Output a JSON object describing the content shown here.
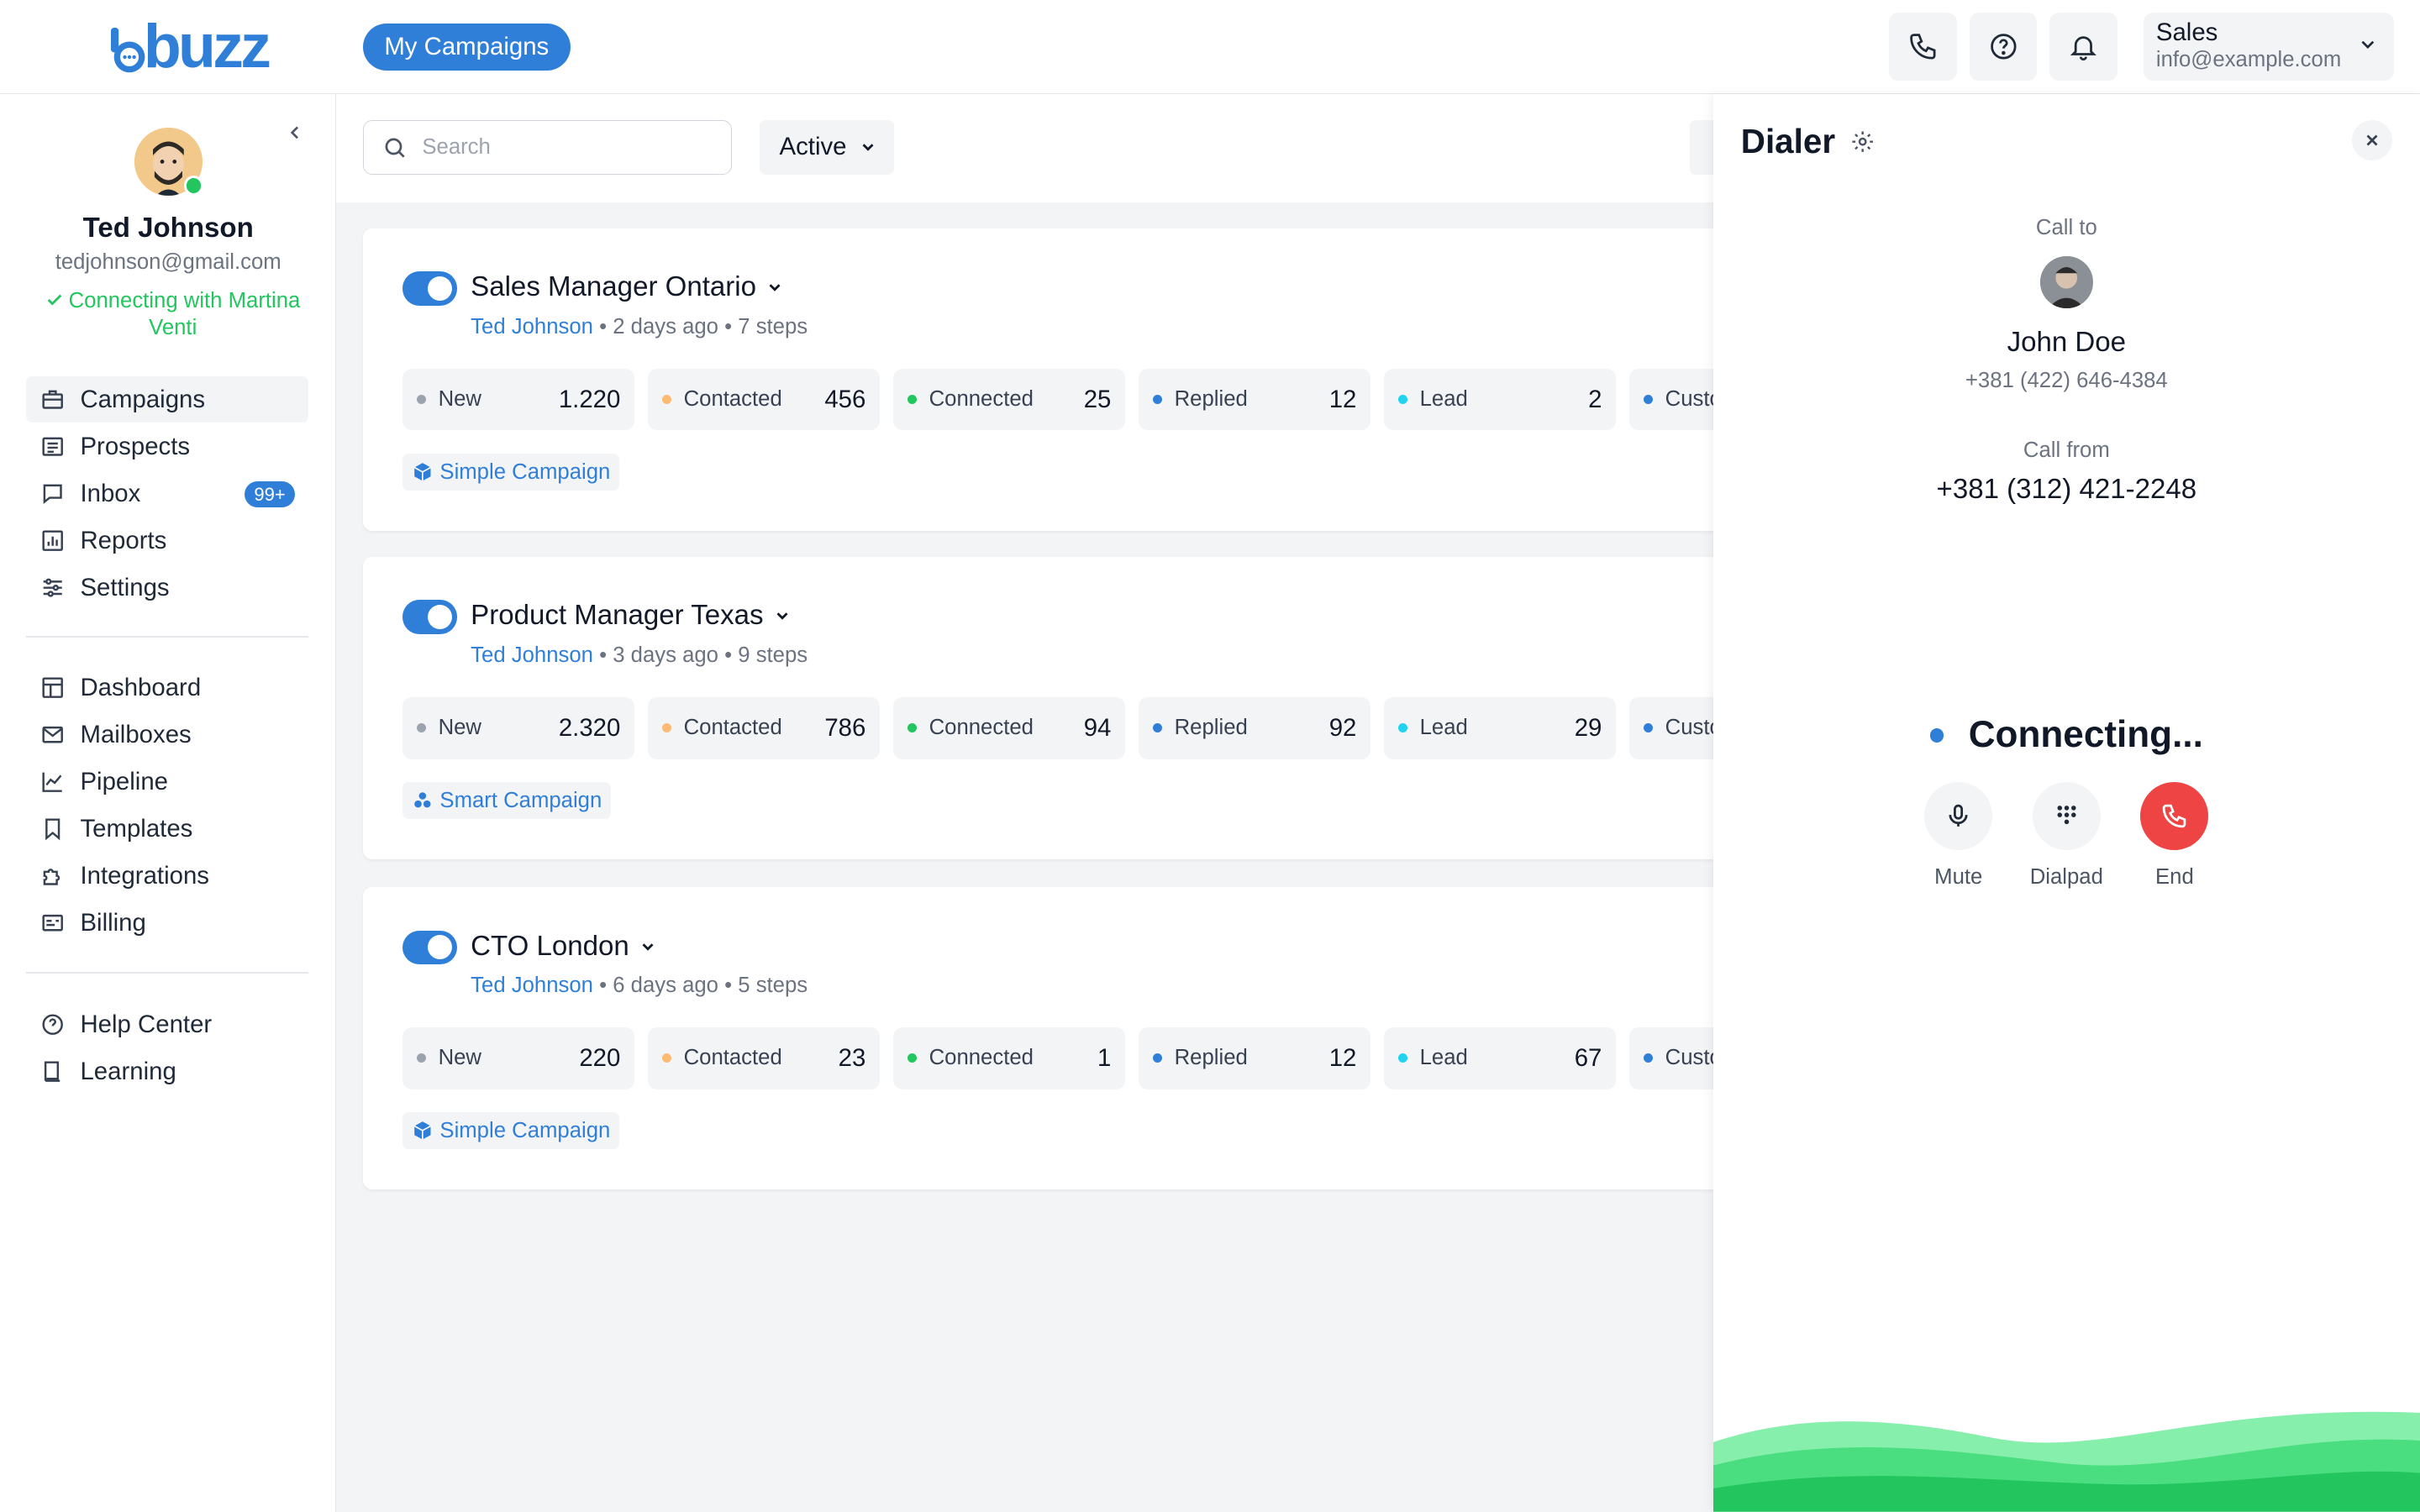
{
  "header": {
    "logo": "buzz",
    "campaigns_button": "My Campaigns",
    "account": {
      "name": "Sales",
      "email": "info@example.com"
    },
    "icons": [
      "phone-icon",
      "help-icon",
      "bell-icon"
    ]
  },
  "sidebar": {
    "user": {
      "name": "Ted Johnson",
      "email": "tedjohnson@gmail.com",
      "status": "Connecting with Martina Venti"
    },
    "primary": [
      {
        "label": "Campaigns",
        "icon": "briefcase-icon",
        "active": true
      },
      {
        "label": "Prospects",
        "icon": "list-icon"
      },
      {
        "label": "Inbox",
        "icon": "chat-icon",
        "badge": "99+"
      },
      {
        "label": "Reports",
        "icon": "chart-icon"
      },
      {
        "label": "Settings",
        "icon": "sliders-icon"
      }
    ],
    "secondary": [
      {
        "label": "Dashboard",
        "icon": "dashboard-icon"
      },
      {
        "label": "Mailboxes",
        "icon": "mail-icon"
      },
      {
        "label": "Pipeline",
        "icon": "pipeline-icon"
      },
      {
        "label": "Templates",
        "icon": "bookmark-icon"
      },
      {
        "label": "Integrations",
        "icon": "puzzle-icon"
      },
      {
        "label": "Billing",
        "icon": "billing-icon"
      }
    ],
    "tertiary": [
      {
        "label": "Help Center",
        "icon": "help-icon"
      },
      {
        "label": "Learning",
        "icon": "book-icon"
      }
    ]
  },
  "toolbar": {
    "search_placeholder": "Search",
    "filter_value": "Active"
  },
  "campaigns": [
    {
      "title": "Sales Manager Ontario",
      "owner": "Ted Johnson",
      "meta": " • 2 days ago • 7 steps",
      "stats": [
        {
          "label": "New",
          "value": "1.220"
        },
        {
          "label": "Contacted",
          "value": "456"
        },
        {
          "label": "Connected",
          "value": "25"
        },
        {
          "label": "Replied",
          "value": "12"
        },
        {
          "label": "Lead",
          "value": "2"
        },
        {
          "label": "Custo",
          "value": ""
        }
      ],
      "tag": "Simple Campaign"
    },
    {
      "title": "Product Manager Texas",
      "owner": "Ted Johnson",
      "meta": " • 3 days ago • 9 steps",
      "stats": [
        {
          "label": "New",
          "value": "2.320"
        },
        {
          "label": "Contacted",
          "value": "786"
        },
        {
          "label": "Connected",
          "value": "94"
        },
        {
          "label": "Replied",
          "value": "92"
        },
        {
          "label": "Lead",
          "value": "29"
        },
        {
          "label": "Custo",
          "value": ""
        }
      ],
      "tag": "Smart Campaign"
    },
    {
      "title": "CTO London",
      "owner": "Ted Johnson",
      "meta": " • 6 days ago • 5 steps",
      "stats": [
        {
          "label": "New",
          "value": "220"
        },
        {
          "label": "Contacted",
          "value": "23"
        },
        {
          "label": "Connected",
          "value": "1"
        },
        {
          "label": "Replied",
          "value": "12"
        },
        {
          "label": "Lead",
          "value": "67"
        },
        {
          "label": "Custo",
          "value": ""
        }
      ],
      "tag": "Simple Campaign"
    }
  ],
  "stat_colors": {
    "New": "#9ca3af",
    "Contacted": "#fdba74",
    "Connected": "#22c55e",
    "Replied": "#2f7fd8",
    "Lead": "#22d3ee",
    "Custo": "#2f7fd8"
  },
  "dialer": {
    "title": "Dialer",
    "call_to_label": "Call to",
    "callee_name": "John Doe",
    "callee_phone": "+381 (422) 646-4384",
    "call_from_label": "Call from",
    "caller_phone": "+381 (312) 421-2248",
    "status": "Connecting...",
    "controls": {
      "mute": "Mute",
      "dialpad": "Dialpad",
      "end": "End"
    }
  },
  "colors": {
    "accent": "#2f7fd8",
    "end": "#ef4444",
    "online": "#22c55e"
  }
}
